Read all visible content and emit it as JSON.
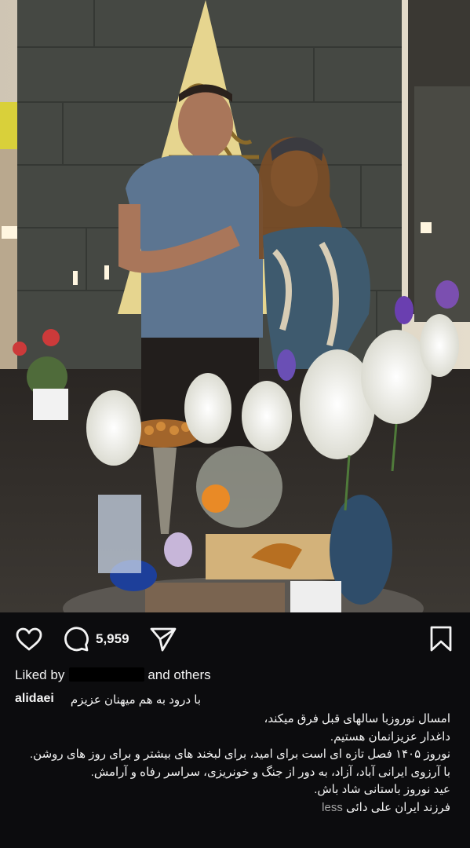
{
  "post": {
    "username": "alidaei",
    "likes_count": "5,959",
    "liked_by_prefix": "Liked by",
    "liked_by_suffix": "and others",
    "caption_first": "با درود به هم میهنان عزیزم",
    "caption_lines": [
      "امسال نوروزبا سالهای قبل فرق میکند،",
      "داغدار عزیزانمان هستیم.",
      "نوروز ۱۴۰۵ فصل تازه ای است برای امید، برای لبخند های بیشتر و برای روز های روشن.",
      "با آرزوی ایرانی آباد، آزاد، به دور از جنگ و خونریزی، سراسر رفاه و آرامش.",
      "عید نوروز باستانی شاد باش.",
      "فرزند ایران علی دائی"
    ],
    "less_label": "less"
  },
  "icons": {
    "like": "heart-icon",
    "comment": "comment-bubble-icon",
    "share": "paper-plane-icon",
    "save": "bookmark-icon"
  },
  "colors": {
    "background": "#0c0c0e",
    "text": "#f4f4f4",
    "muted": "#a6a6a6"
  }
}
